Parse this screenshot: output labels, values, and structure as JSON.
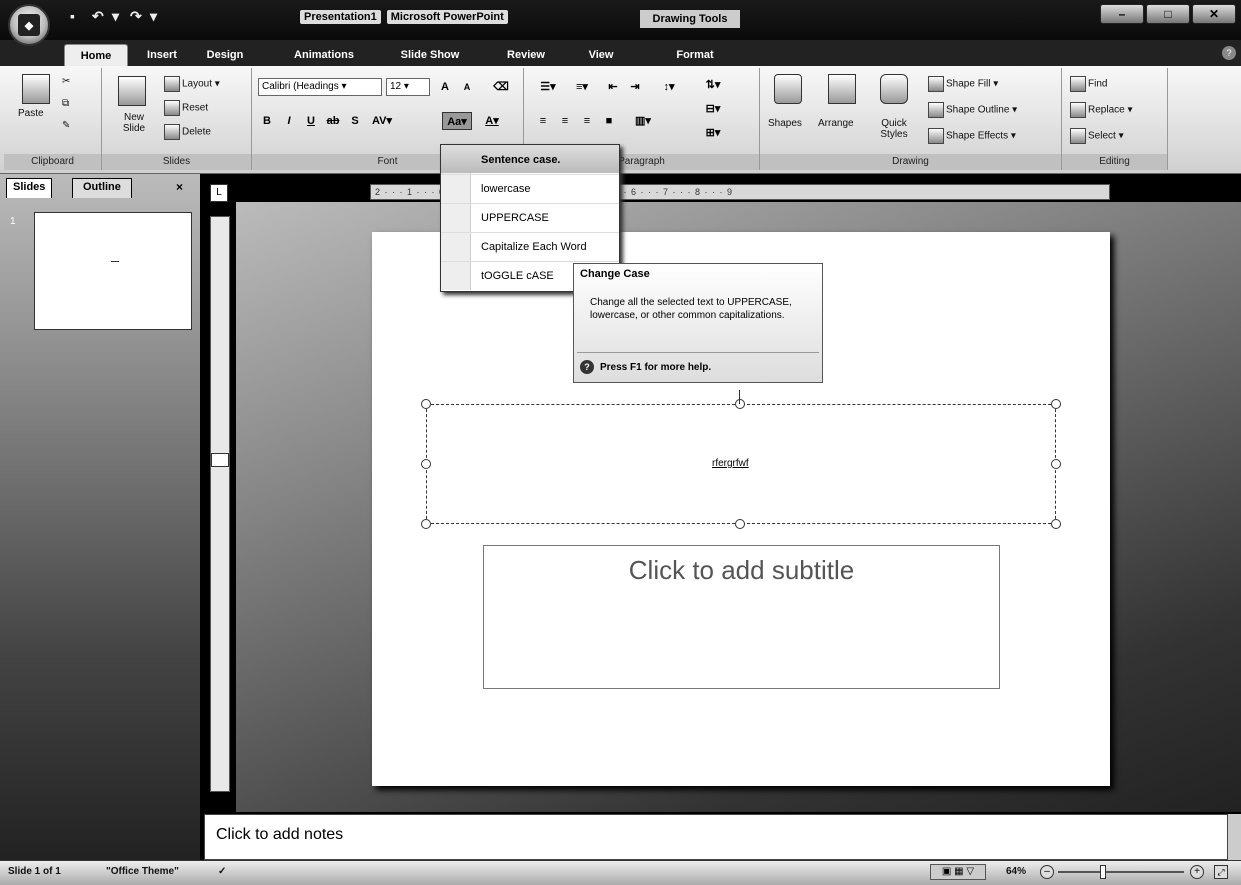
{
  "titlebar": {
    "doc_name": "Presentation1",
    "app_name": "Microsoft PowerPoint",
    "contextual_tab_group": "Drawing Tools"
  },
  "tabs": [
    "Home",
    "Insert",
    "Design",
    "Animations",
    "Slide Show",
    "Review",
    "View",
    "Format"
  ],
  "ribbon": {
    "clipboard": {
      "paste": "Paste",
      "label": "Clipboard"
    },
    "slides": {
      "new_slide": "New Slide",
      "layout": "Layout",
      "reset": "Reset",
      "delete": "Delete",
      "label": "Slides"
    },
    "font": {
      "font_name": "Calibri (Headings",
      "font_size": "12",
      "label": "Font",
      "change_case": "Aa"
    },
    "paragraph": {
      "label": "Paragraph"
    },
    "drawing": {
      "shapes": "Shapes",
      "arrange": "Arrange",
      "quick_styles": "Quick Styles",
      "shape_fill": "Shape Fill",
      "shape_outline": "Shape Outline",
      "shape_effects": "Shape Effects",
      "label": "Drawing"
    },
    "editing": {
      "find": "Find",
      "replace": "Replace",
      "select": "Select",
      "label": "Editing"
    }
  },
  "pane": {
    "slides_tab": "Slides",
    "outline_tab": "Outline",
    "slide_number": "1"
  },
  "ruler": {
    "marks": "2 · · · 1 · · · 0 · · · 1 · · · 2 · · · 3 · · · 4 · · · 5 · · · 6 · · · 7 · · · 8 · · · 9"
  },
  "change_case_menu": {
    "items": [
      "Sentence case.",
      "lowercase",
      "UPPERCASE",
      "Capitalize Each Word",
      "tOGGLE cASE"
    ]
  },
  "tooltip": {
    "title": "Change Case",
    "body": "Change all the selected text to UPPERCASE, lowercase, or other common capitalizations.",
    "help": "Press F1 for more help."
  },
  "slide": {
    "title_text": "rfergrfwf",
    "subtitle_placeholder": "Click to add subtitle"
  },
  "notes": {
    "placeholder": "Click to add notes"
  },
  "status": {
    "slide_info": "Slide 1 of 1",
    "theme": "\"Office Theme\"",
    "zoom": "64%"
  }
}
